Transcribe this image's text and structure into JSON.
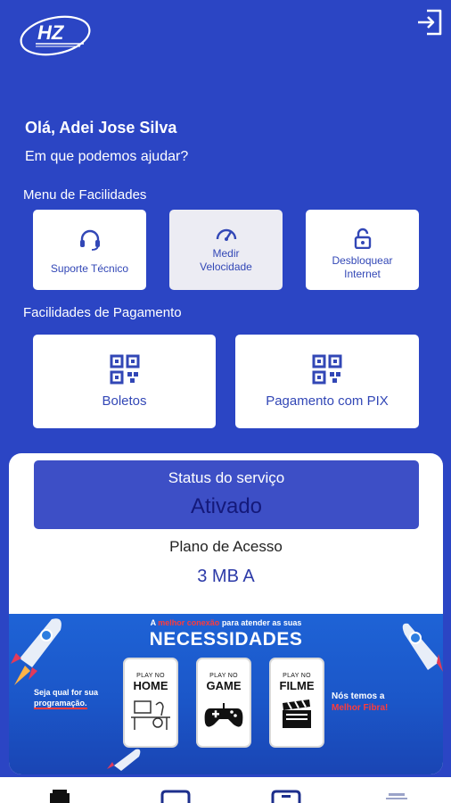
{
  "brand": {
    "logo_text": "HZ",
    "accent": "#2b45c4"
  },
  "header": {
    "logout_icon": "logout-icon"
  },
  "greeting": {
    "hello": "Olá, Adei Jose Silva",
    "question": "Em que podemos ajudar?"
  },
  "facilities": {
    "title": "Menu de Facilidades",
    "items": [
      {
        "label": "Suporte Técnico",
        "icon": "headset-icon"
      },
      {
        "label": "Medir\nVelocidade",
        "icon": "speedometer-icon"
      },
      {
        "label": "Desbloquear\nInternet",
        "icon": "unlock-icon"
      }
    ]
  },
  "payments": {
    "title": "Facilidades de Pagamento",
    "items": [
      {
        "label": "Boletos",
        "icon": "qr-code-icon"
      },
      {
        "label": "Pagamento com PIX",
        "icon": "qr-code-icon"
      }
    ]
  },
  "service": {
    "status_title": "Status do serviço",
    "status_value": "Ativado",
    "plan_title": "Plano de Acesso",
    "plan_value": "3 MB A"
  },
  "banner": {
    "top_a": "A ",
    "top_highlight": "melhor conexão",
    "top_b": " para atender as suas",
    "headline": "NECESSIDADES",
    "left_line1": "Seja qual for sua",
    "left_line2": "programação.",
    "right_line1": "Nós temos a",
    "right_line2": "Melhor Fibra!",
    "cards": [
      {
        "small": "PLAY NO",
        "big": "HOME"
      },
      {
        "small": "PLAY NO",
        "big": "GAME"
      },
      {
        "small": "PLAY NO",
        "big": "FILME"
      }
    ]
  },
  "bottom_nav": {
    "items": [
      {
        "icon": "home-icon"
      },
      {
        "icon": "invoice-icon"
      },
      {
        "icon": "wallet-icon"
      },
      {
        "icon": "profile-icon"
      }
    ]
  }
}
